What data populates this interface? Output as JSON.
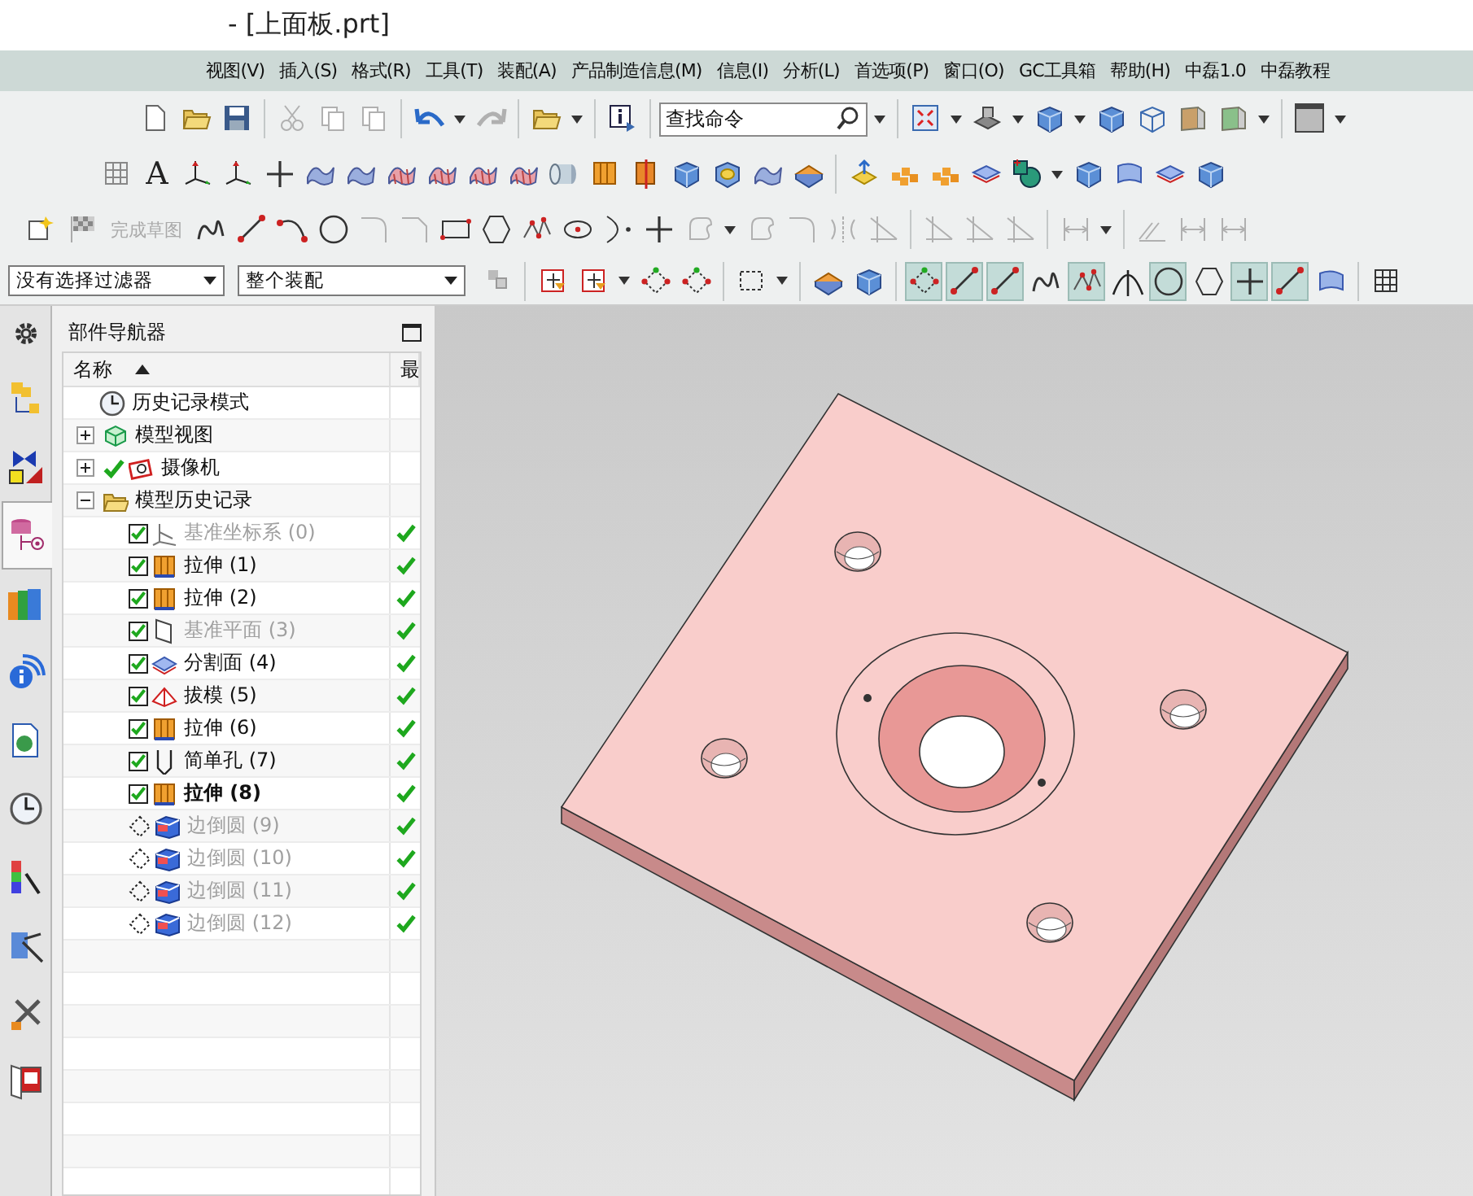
{
  "window": {
    "title": "- [上面板.prt]"
  },
  "menu": [
    "视图(V)",
    "插入(S)",
    "格式(R)",
    "工具(T)",
    "装配(A)",
    "产品制造信息(M)",
    "信息(I)",
    "分析(L)",
    "首选项(P)",
    "窗口(O)",
    "GC工具箱",
    "帮助(H)",
    "中磊1.0",
    "中磊教程"
  ],
  "toolbar": {
    "text_tool": {
      "glyph": "A"
    },
    "search": {
      "placeholder": "查找命令"
    },
    "finish_sketch": {
      "label": "完成草图",
      "disabled": true
    }
  },
  "selection_bar": {
    "filter": "没有选择过滤器",
    "scope": "整个装配",
    "snap_buttons": [
      {
        "selected": true
      },
      {
        "selected": true
      },
      {
        "selected": true
      },
      {
        "selected": false
      },
      {
        "selected": true
      },
      {
        "selected": false
      },
      {
        "selected": true
      },
      {
        "selected": false
      },
      {
        "selected": true
      },
      {
        "selected": true
      },
      {
        "selected": false
      }
    ]
  },
  "resource_tabs": [
    {
      "kind": "assembly",
      "selected": false
    },
    {
      "kind": "constraints",
      "selected": false
    },
    {
      "kind": "part",
      "selected": true
    },
    {
      "kind": "library",
      "selected": false
    },
    {
      "kind": "info",
      "selected": false
    },
    {
      "kind": "web",
      "selected": false
    },
    {
      "kind": "history",
      "selected": false
    },
    {
      "kind": "palette",
      "selected": false
    },
    {
      "kind": "visual",
      "selected": false
    },
    {
      "kind": "tools",
      "selected": false
    },
    {
      "kind": "roles",
      "selected": false
    }
  ],
  "navigator": {
    "title": "部件导航器",
    "columns": [
      {
        "label": "名称",
        "sorted": true
      },
      {
        "label": "最"
      }
    ],
    "tree": [
      {
        "label": "历史记录模式",
        "kind": "clock"
      },
      {
        "label": "模型视图",
        "kind": "views",
        "expanded": false
      },
      {
        "label": "摄像机",
        "kind": "camera",
        "expanded": false,
        "checked": true
      },
      {
        "label": "模型历史记录",
        "kind": "folder",
        "expanded": true,
        "children": [
          {
            "label": "基准坐标系 (0)",
            "kind": "csys",
            "suppressed": false,
            "checked": true,
            "dimmed": true,
            "current": false,
            "up_to_date": true
          },
          {
            "label": "拉伸 (1)",
            "kind": "extrude",
            "suppressed": false,
            "checked": true,
            "dimmed": false,
            "current": false,
            "up_to_date": true
          },
          {
            "label": "拉伸 (2)",
            "kind": "extrude",
            "suppressed": false,
            "checked": true,
            "dimmed": false,
            "current": false,
            "up_to_date": true
          },
          {
            "label": "基准平面 (3)",
            "kind": "plane",
            "suppressed": false,
            "checked": true,
            "dimmed": true,
            "current": false,
            "up_to_date": true
          },
          {
            "label": "分割面 (4)",
            "kind": "split",
            "suppressed": false,
            "checked": true,
            "dimmed": false,
            "current": false,
            "up_to_date": true
          },
          {
            "label": "拔模 (5)",
            "kind": "draft",
            "suppressed": false,
            "checked": true,
            "dimmed": false,
            "current": false,
            "up_to_date": true
          },
          {
            "label": "拉伸 (6)",
            "kind": "extrude",
            "suppressed": false,
            "checked": true,
            "dimmed": false,
            "current": false,
            "up_to_date": true
          },
          {
            "label": "简单孔 (7)",
            "kind": "hole",
            "suppressed": false,
            "checked": true,
            "dimmed": false,
            "current": false,
            "up_to_date": true
          },
          {
            "label": "拉伸 (8)",
            "kind": "extrude",
            "suppressed": false,
            "checked": true,
            "dimmed": false,
            "current": true,
            "up_to_date": true
          },
          {
            "label": "边倒圆 (9)",
            "kind": "blend",
            "suppressed": true,
            "dimmed": true,
            "current": false,
            "up_to_date": true
          },
          {
            "label": "边倒圆 (10)",
            "kind": "blend",
            "suppressed": true,
            "dimmed": true,
            "current": false,
            "up_to_date": true
          },
          {
            "label": "边倒圆 (11)",
            "kind": "blend",
            "suppressed": true,
            "dimmed": true,
            "current": false,
            "up_to_date": true
          },
          {
            "label": "边倒圆 (12)",
            "kind": "blend",
            "suppressed": true,
            "dimmed": true,
            "current": false,
            "up_to_date": true
          }
        ]
      }
    ]
  }
}
